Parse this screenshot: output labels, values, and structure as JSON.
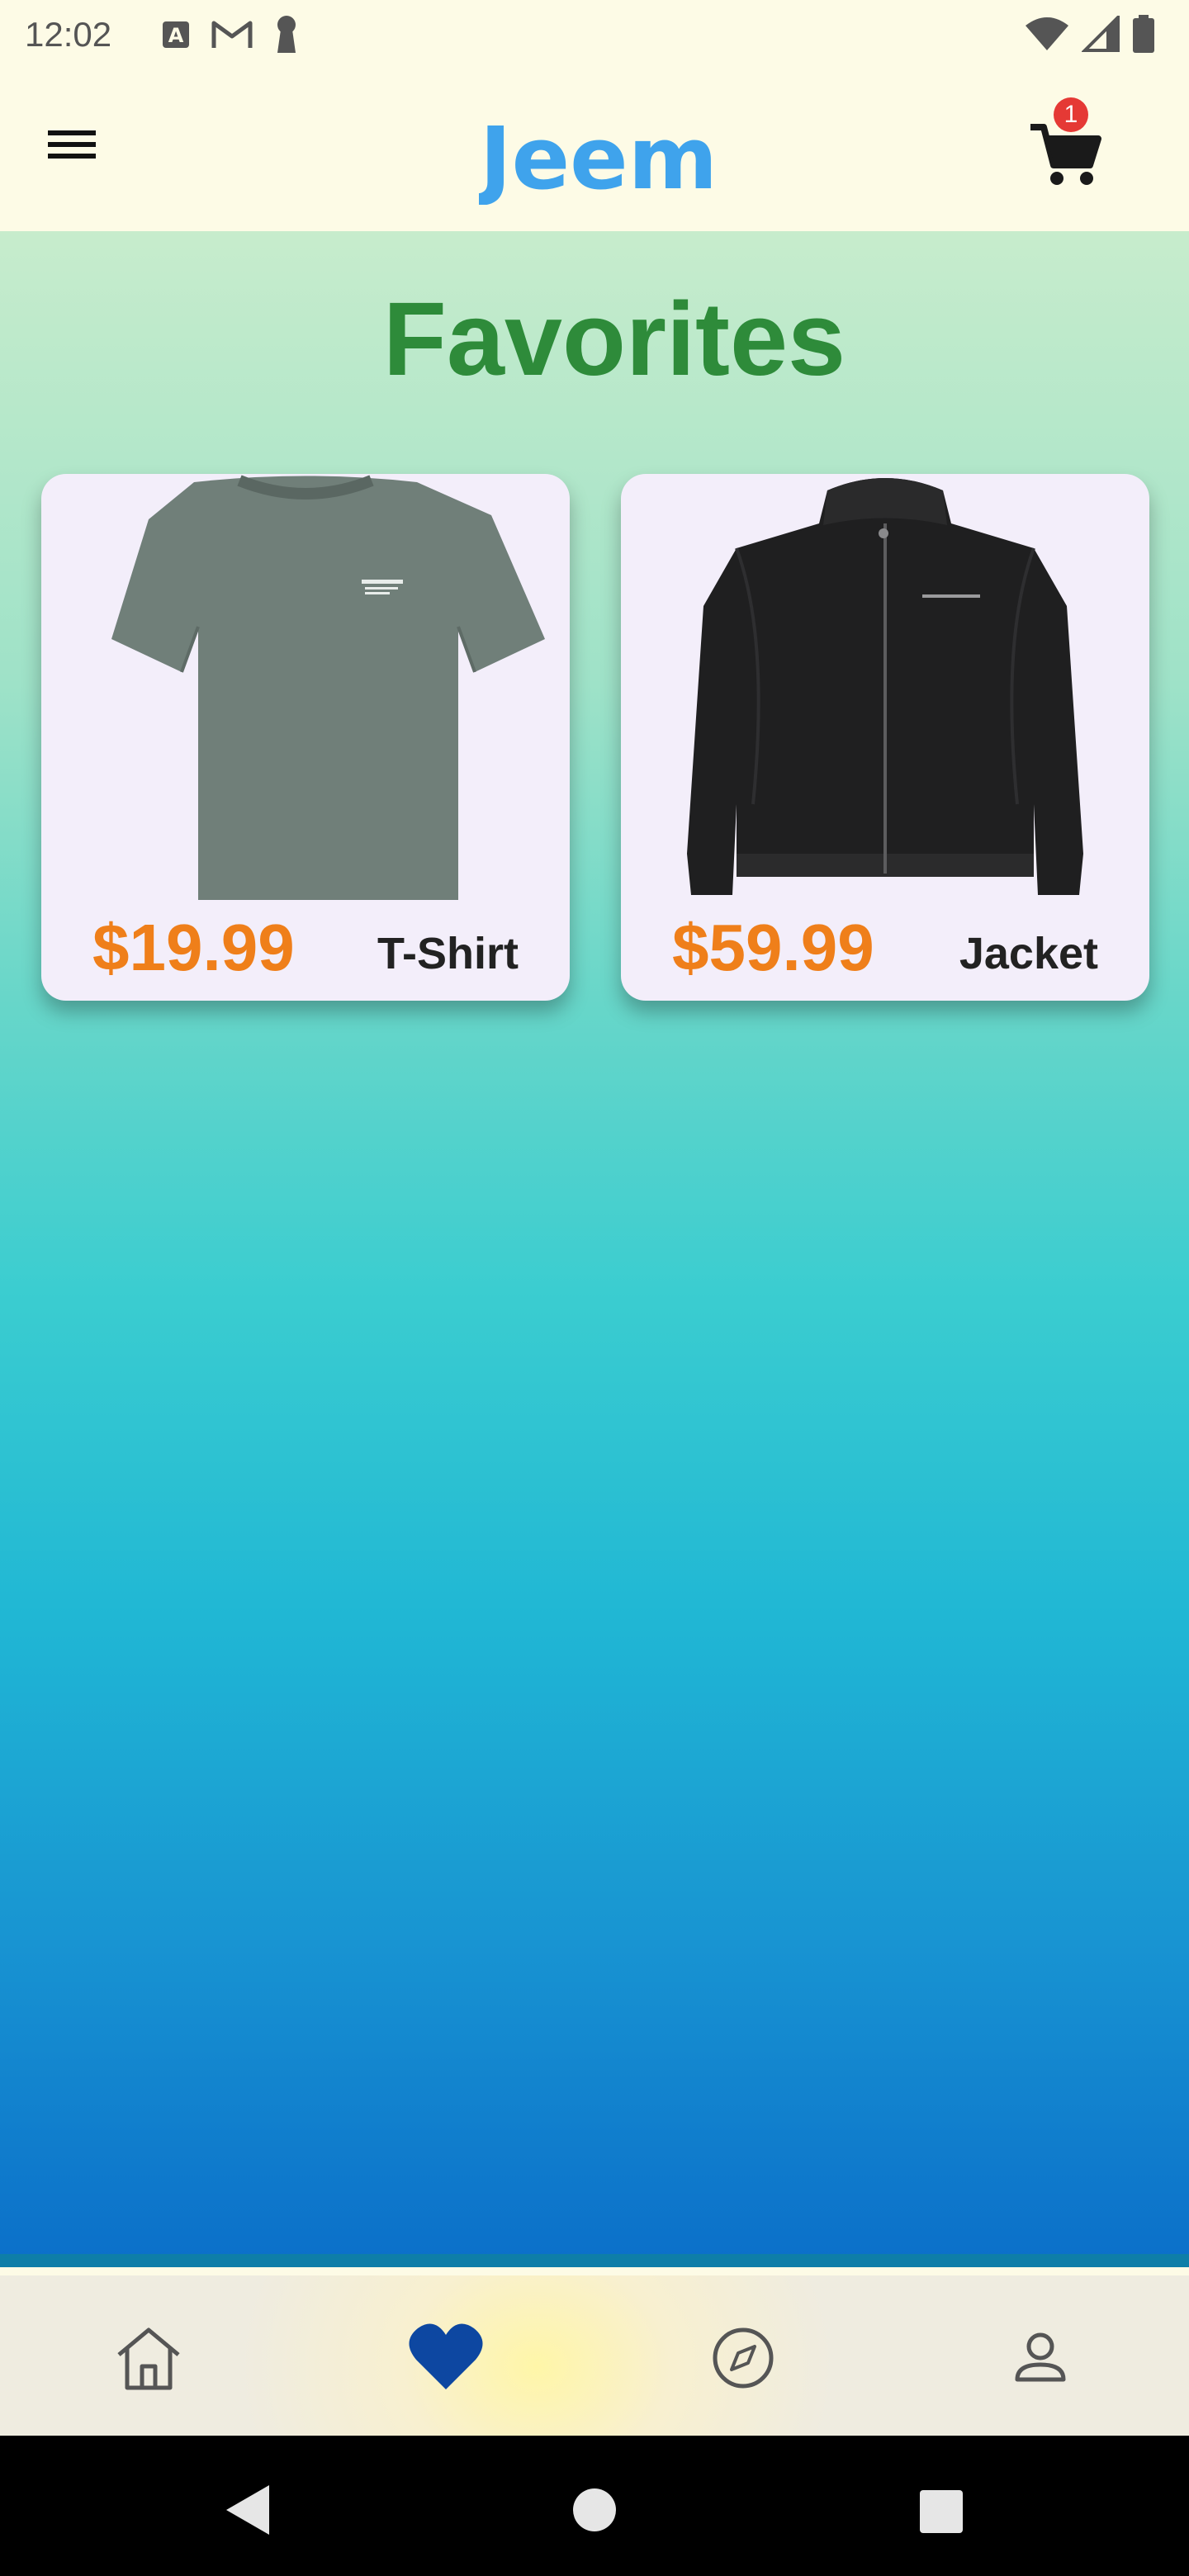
{
  "status_bar": {
    "time": "12:02",
    "left_icons": [
      "font-a-icon",
      "gmail-icon",
      "keyhole-icon"
    ],
    "right_icons": [
      "wifi-icon",
      "signal-icon",
      "battery-icon"
    ]
  },
  "app_bar": {
    "menu_icon": "hamburger-menu-icon",
    "logo_text": "Jeem",
    "cart_icon": "shopping-cart-icon",
    "cart_count": "1"
  },
  "page": {
    "title": "Favorites"
  },
  "favorites": [
    {
      "price": "$19.99",
      "name": "T-Shirt",
      "image": "gray-t-shirt"
    },
    {
      "price": "$59.99",
      "name": "Jacket",
      "image": "black-jacket"
    }
  ],
  "bottom_nav": {
    "items": [
      {
        "icon": "home-icon",
        "active": false
      },
      {
        "icon": "heart-icon",
        "active": true
      },
      {
        "icon": "compass-icon",
        "active": false
      },
      {
        "icon": "profile-icon",
        "active": false
      }
    ]
  },
  "system_nav": [
    "back-icon",
    "home-circle-icon",
    "recents-icon"
  ],
  "colors": {
    "title_green": "#2e8b3a",
    "price_orange": "#ef7f1a",
    "logo_blue": "#3fa3ec",
    "active_nav_blue": "#0d47a1",
    "badge_red": "#e53935"
  }
}
